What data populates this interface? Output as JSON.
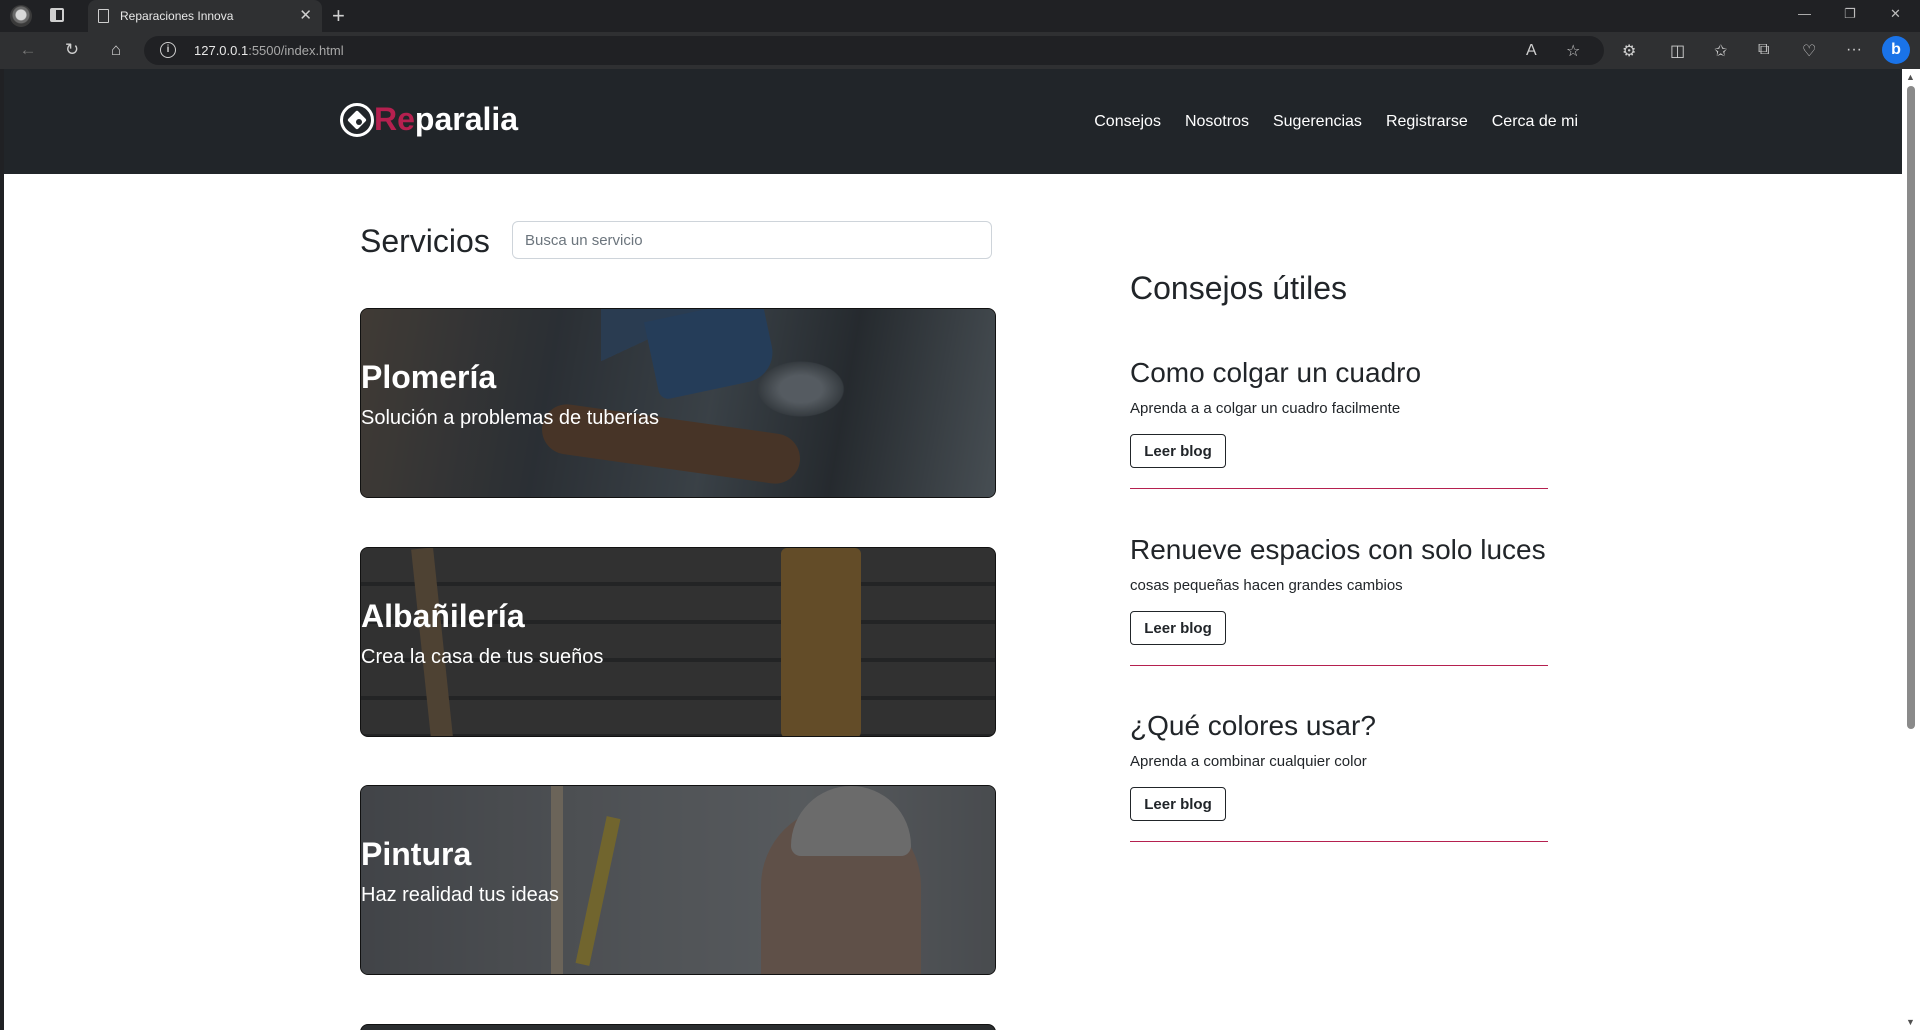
{
  "browser": {
    "tab_title": "Reparaciones Innova",
    "url_host": "127.0.0.1",
    "url_rest": ":5500/index.html"
  },
  "site": {
    "brand_accent": "Re",
    "brand_rest": "paralia",
    "nav": [
      "Consejos",
      "Nosotros",
      "Sugerencias",
      "Registrarse",
      "Cerca de mi"
    ]
  },
  "services": {
    "title": "Servicios",
    "search_placeholder": "Busca un servicio",
    "cards": [
      {
        "title": "Plomería",
        "subtitle": "Solución a problemas de tuberías"
      },
      {
        "title": "Albañilería",
        "subtitle": "Crea la casa de tus sueños"
      },
      {
        "title": "Pintura",
        "subtitle": "Haz realidad tus ideas"
      }
    ]
  },
  "tips": {
    "title": "Consejos útiles",
    "items": [
      {
        "title": "Como colgar un cuadro",
        "desc": "Aprenda a a colgar un cuadro facilmente",
        "button": "Leer blog"
      },
      {
        "title": "Renueve espacios con solo luces",
        "desc": "cosas pequeñas hacen grandes cambios",
        "button": "Leer blog"
      },
      {
        "title": "¿Qué colores usar?",
        "desc": "Aprenda a combinar cualquier color",
        "button": "Leer blog"
      }
    ]
  },
  "colors": {
    "header_bg": "#212529",
    "accent": "#b5204f",
    "text": "#212529"
  }
}
